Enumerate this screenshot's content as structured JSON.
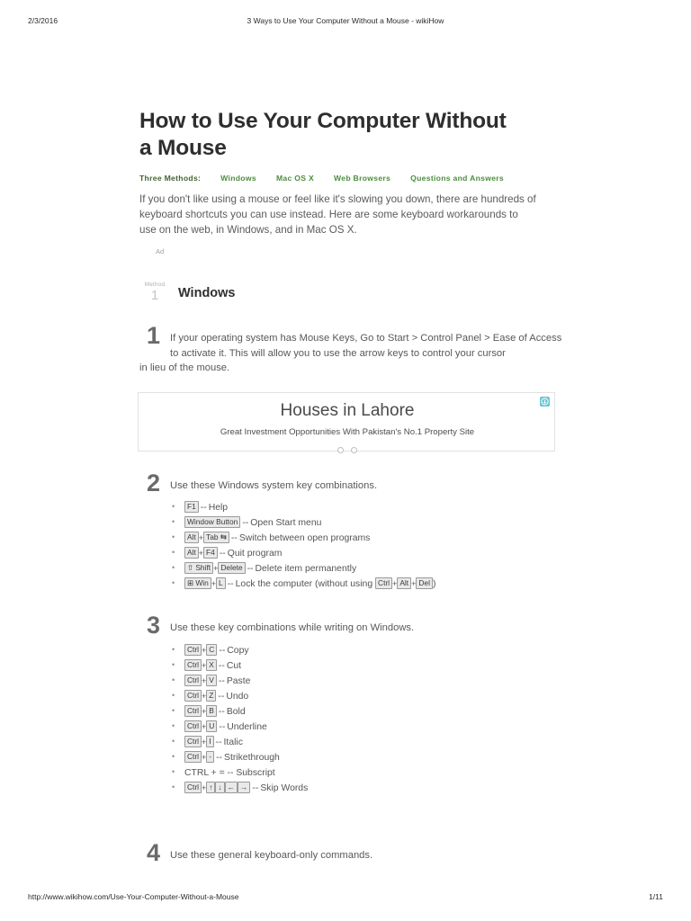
{
  "print_header": {
    "date": "2/3/2016",
    "doc_title": "3 Ways to Use Your Computer Without a Mouse - wikiHow"
  },
  "print_footer": {
    "url": "http://www.wikihow.com/Use-Your-Computer-Without-a-Mouse",
    "page": "1/11"
  },
  "article": {
    "title": "How to Use Your Computer Without a Mouse",
    "methods_label": "Three Methods:",
    "method_links": [
      "Windows",
      "Mac OS X",
      "Web Browsers",
      "Questions and Answers"
    ],
    "intro": "If you don't like using a mouse or feel like it's slowing you down, there are hundreds of keyboard shortcuts you can use instead. Here are some keyboard workarounds to use on the web, in Windows, and in Mac OS X.",
    "ad_label": "Ad"
  },
  "method": {
    "badge_word": "Method",
    "badge_number": "1",
    "title": "Windows"
  },
  "steps": [
    {
      "number": "1",
      "text_part1": "If your operating system has Mouse Keys, Go to Start > Control Panel > Ease of Access to activate it. This will allow you to use the arrow keys to control your cursor",
      "text_part2": "in lieu of the mouse."
    },
    {
      "number": "2",
      "text": "Use these Windows system key combinations."
    },
    {
      "number": "3",
      "text": "Use these key combinations while writing on Windows."
    },
    {
      "number": "4",
      "text": "Use these general keyboard-only commands."
    }
  ],
  "shortcuts_system": [
    {
      "keys": [
        "F1"
      ],
      "desc": "Help"
    },
    {
      "keys": [
        "Window Button"
      ],
      "desc": "Open Start menu"
    },
    {
      "keys": [
        "Alt",
        "Tab ⇆"
      ],
      "desc": "Switch between open programs"
    },
    {
      "keys": [
        "Alt",
        "F4"
      ],
      "desc": "Quit program"
    },
    {
      "keys": [
        "⇧ Shift",
        "Delete"
      ],
      "desc": "Delete item permanently"
    },
    {
      "keys": [
        "⊞ Win",
        "L"
      ],
      "desc": "Lock the computer (without using",
      "trailing_keys": [
        "Ctrl",
        "Alt",
        "Del"
      ],
      "desc_end": ")"
    }
  ],
  "shortcuts_writing": [
    {
      "keys": [
        "Ctrl",
        "C"
      ],
      "desc": "Copy"
    },
    {
      "keys": [
        "Ctrl",
        "X"
      ],
      "desc": "Cut"
    },
    {
      "keys": [
        "Ctrl",
        "V"
      ],
      "desc": "Paste"
    },
    {
      "keys": [
        "Ctrl",
        "Z"
      ],
      "desc": "Undo"
    },
    {
      "keys": [
        "Ctrl",
        "B"
      ],
      "desc": "Bold"
    },
    {
      "keys": [
        "Ctrl",
        "U"
      ],
      "desc": "Underline"
    },
    {
      "keys": [
        "Ctrl",
        "I"
      ],
      "desc": "Italic"
    },
    {
      "keys": [
        "Ctrl",
        "-"
      ],
      "desc": "Strikethrough"
    },
    {
      "plain": "CTRL + = -- Subscript"
    },
    {
      "keys": [
        "Ctrl",
        "↑",
        "↓",
        "←",
        "→"
      ],
      "desc": "Skip Words"
    }
  ],
  "advertisement": {
    "headline": "Houses in Lahore",
    "subtext": "Great Investment Opportunities With Pakistan's No.1 Property Site",
    "dots": 2,
    "adchoices_icon": "info-icon",
    "adchoices_color": "#6cc4d6"
  },
  "separator": "--"
}
